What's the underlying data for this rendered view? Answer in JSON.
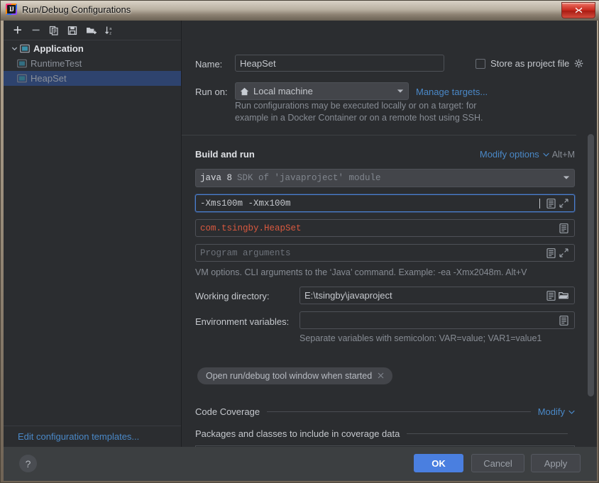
{
  "window": {
    "title": "Run/Debug Configurations",
    "app_icon": "intellij-idea-icon",
    "close_label": "✕"
  },
  "sidebar": {
    "toolbar": [
      {
        "name": "add-configuration-button",
        "icon": "plus-icon",
        "label": "+"
      },
      {
        "name": "remove-configuration-button",
        "icon": "minus-icon",
        "label": "−"
      },
      {
        "name": "copy-configuration-button",
        "icon": "copy-icon",
        "label": "Copy"
      },
      {
        "name": "save-configuration-button",
        "icon": "save-icon",
        "label": "Save"
      },
      {
        "name": "move-into-folder-button",
        "icon": "folder-add-icon",
        "label": "Folder"
      },
      {
        "name": "sort-configurations-button",
        "icon": "sort-alpha-icon",
        "label": "Sort"
      }
    ],
    "tree": [
      {
        "label": "Application",
        "type": "group",
        "expanded": true,
        "icon": "application-icon",
        "selected": false
      },
      {
        "label": "RuntimeTest",
        "type": "child",
        "icon": "configuration-icon",
        "selected": false
      },
      {
        "label": "HeapSet",
        "type": "child",
        "icon": "configuration-icon",
        "selected": true
      }
    ],
    "edit_templates_link": "Edit configuration templates..."
  },
  "form": {
    "name_label": "Name:",
    "name_value": "HeapSet",
    "store_as_project_file_label": "Store as project file",
    "store_as_project_file_checked": false,
    "store_gear_icon": "gear-icon",
    "run_on_label": "Run on:",
    "run_on_value": "Local machine",
    "run_on_icon": "home-icon",
    "manage_targets_link": "Manage targets...",
    "run_on_hint_line1": "Run configurations may be executed locally or on a target: for",
    "run_on_hint_line2": "example in a Docker Container or on a remote host using SSH."
  },
  "build_and_run": {
    "title": "Build and run",
    "modify_options_link": "Modify options",
    "modify_options_shortcut": "Alt+M",
    "jre_value_primary": "java 8",
    "jre_value_secondary": "SDK of 'javaproject' module",
    "vm_options_value": "-Xms100m -Xmx100m",
    "main_class_value": "com.tsingby.HeapSet",
    "main_class_color": "#d9593f",
    "program_arguments_placeholder": "Program arguments",
    "vm_options_hint": "VM options. CLI arguments to the   ‘Java’   command. Example: -ea -Xmx2048m. Alt+V",
    "working_directory_label": "Working directory:",
    "working_directory_value": "E:\\tsingby\\javaproject",
    "environment_variables_label": "Environment variables:",
    "environment_variables_value": "",
    "environment_variables_hint": "Separate variables with semicolon: VAR=value; VAR1=value1",
    "chip_label": "Open run/debug tool window when started",
    "chip_close_icon": "close-icon",
    "icons": {
      "macro_icon": "list-icon",
      "expand_icon": "expand-diagonal-icon",
      "browse_icon": "folder-open-icon"
    }
  },
  "code_coverage": {
    "title": "Code Coverage",
    "modify_link": "Modify",
    "packages_title": "Packages and classes to include in coverage data",
    "toolbar": [
      {
        "name": "remove-package-button",
        "icon": "minus-icon",
        "label": "−"
      },
      {
        "name": "add-package-button",
        "icon": "plus-dropdown-icon",
        "label": "+"
      }
    ]
  },
  "footer": {
    "help_label": "?",
    "ok_label": "OK",
    "cancel_label": "Cancel",
    "apply_label": "Apply"
  },
  "colors": {
    "accent_blue": "#4a7fe0",
    "link_blue": "#4a88c7",
    "panel_bg": "#2b2d30",
    "dialog_bg": "#3c3f41",
    "selection_bg": "#2e436e",
    "class_orange": "#d9593f"
  }
}
